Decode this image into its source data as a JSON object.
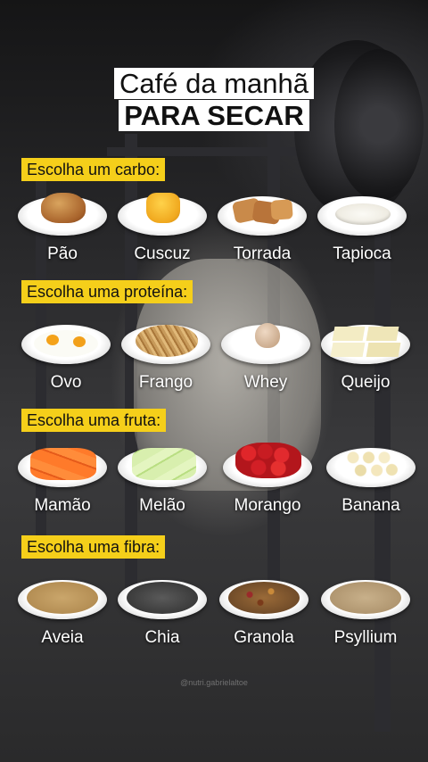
{
  "title": {
    "line1": "Café da manhã",
    "line2": "PARA SECAR"
  },
  "sections": [
    {
      "label": "Escolha um carbo:",
      "items": [
        {
          "name": "Pão",
          "icon": "bread-icon"
        },
        {
          "name": "Cuscuz",
          "icon": "couscous-icon"
        },
        {
          "name": "Torrada",
          "icon": "toast-icon"
        },
        {
          "name": "Tapioca",
          "icon": "tapioca-icon"
        }
      ]
    },
    {
      "label": "Escolha uma proteína:",
      "items": [
        {
          "name": "Ovo",
          "icon": "egg-icon"
        },
        {
          "name": "Frango",
          "icon": "chicken-icon"
        },
        {
          "name": "Whey",
          "icon": "whey-icon"
        },
        {
          "name": "Queijo",
          "icon": "cheese-icon"
        }
      ]
    },
    {
      "label": "Escolha uma fruta:",
      "items": [
        {
          "name": "Mamão",
          "icon": "papaya-icon"
        },
        {
          "name": "Melão",
          "icon": "melon-icon"
        },
        {
          "name": "Morango",
          "icon": "strawberry-icon"
        },
        {
          "name": "Banana",
          "icon": "banana-icon"
        }
      ]
    },
    {
      "label": "Escolha uma fibra:",
      "items": [
        {
          "name": "Aveia",
          "icon": "oats-icon"
        },
        {
          "name": "Chia",
          "icon": "chia-icon"
        },
        {
          "name": "Granola",
          "icon": "granola-icon"
        },
        {
          "name": "Psyllium",
          "icon": "psyllium-icon"
        }
      ]
    }
  ],
  "watermark": "@nutri.gabrielaltoe",
  "colors": {
    "label_bg": "#f5cf1a",
    "title_bg": "#ffffff",
    "text": "#ffffff"
  }
}
